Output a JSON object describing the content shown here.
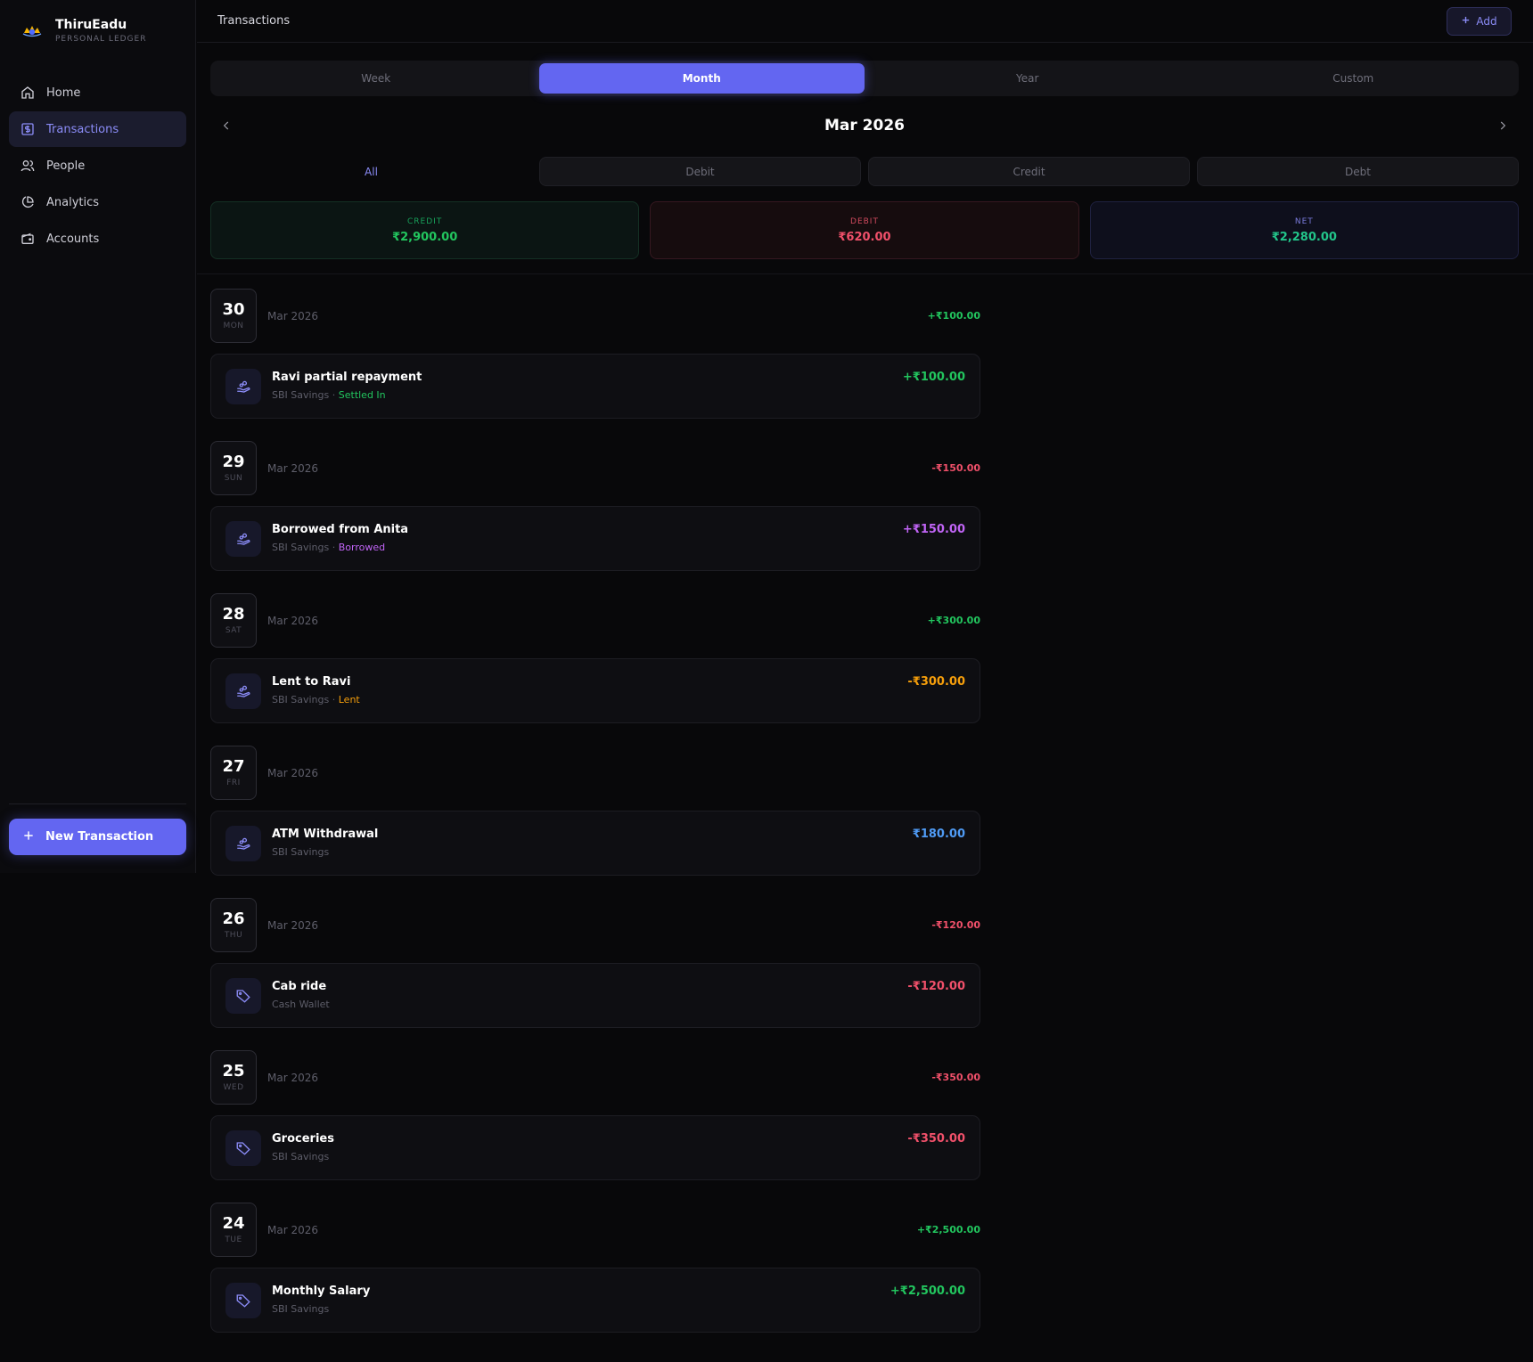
{
  "app": {
    "name": "ThiruEadu",
    "subtitle": "PERSONAL LEDGER"
  },
  "sidebar": {
    "items": [
      {
        "label": "Home",
        "icon": "home-icon",
        "active": false
      },
      {
        "label": "Transactions",
        "icon": "dollar-square-icon",
        "active": true
      },
      {
        "label": "People",
        "icon": "people-icon",
        "active": false
      },
      {
        "label": "Analytics",
        "icon": "pie-chart-icon",
        "active": false
      },
      {
        "label": "Accounts",
        "icon": "wallet-icon",
        "active": false
      }
    ],
    "new_button": "New Transaction"
  },
  "header": {
    "title": "Transactions",
    "add_label": "Add"
  },
  "period_tabs": [
    "Week",
    "Month",
    "Year",
    "Custom"
  ],
  "period_active": "Month",
  "month_label": "Mar 2026",
  "type_tabs": [
    "All",
    "Debit",
    "Credit",
    "Debt"
  ],
  "type_active": "All",
  "summary": {
    "credit_label": "CREDIT",
    "credit_value": "₹2,900.00",
    "debit_label": "DEBIT",
    "debit_value": "₹620.00",
    "net_label": "NET",
    "net_value": "₹2,280.00"
  },
  "colors": {
    "accent": "#6366f1",
    "green": "#22c55e",
    "red": "#f0506a",
    "purple": "#c064f5",
    "orange": "#f59e0b",
    "blue": "#4f9bf5"
  },
  "days": [
    {
      "day": "30",
      "dow": "MON",
      "month": "Mar 2026",
      "total": "+₹100.00",
      "total_color": "green",
      "tx": {
        "title": "Ravi partial repayment",
        "account": "SBI Savings",
        "tag": "Settled In",
        "tag_color": "green",
        "amount": "+₹100.00",
        "amount_color": "green",
        "icon": "hand-coins-icon"
      }
    },
    {
      "day": "29",
      "dow": "SUN",
      "month": "Mar 2026",
      "total": "-₹150.00",
      "total_color": "red",
      "tx": {
        "title": "Borrowed from Anita",
        "account": "SBI Savings",
        "tag": "Borrowed",
        "tag_color": "purple",
        "amount": "+₹150.00",
        "amount_color": "purple",
        "icon": "hand-coins-icon"
      }
    },
    {
      "day": "28",
      "dow": "SAT",
      "month": "Mar 2026",
      "total": "+₹300.00",
      "total_color": "green",
      "tx": {
        "title": "Lent to Ravi",
        "account": "SBI Savings",
        "tag": "Lent",
        "tag_color": "orange",
        "amount": "-₹300.00",
        "amount_color": "orange",
        "icon": "hand-coins-icon"
      }
    },
    {
      "day": "27",
      "dow": "FRI",
      "month": "Mar 2026",
      "total": "",
      "total_color": "green",
      "tx": {
        "title": "ATM Withdrawal",
        "account": "SBI Savings",
        "tag": "",
        "tag_color": "",
        "amount": "₹180.00",
        "amount_color": "blue",
        "icon": "hand-coins-icon"
      }
    },
    {
      "day": "26",
      "dow": "THU",
      "month": "Mar 2026",
      "total": "-₹120.00",
      "total_color": "red",
      "tx": {
        "title": "Cab ride",
        "account": "Cash Wallet",
        "tag": "",
        "tag_color": "",
        "amount": "-₹120.00",
        "amount_color": "red",
        "icon": "tag-icon"
      }
    },
    {
      "day": "25",
      "dow": "WED",
      "month": "Mar 2026",
      "total": "-₹350.00",
      "total_color": "red",
      "tx": {
        "title": "Groceries",
        "account": "SBI Savings",
        "tag": "",
        "tag_color": "",
        "amount": "-₹350.00",
        "amount_color": "red",
        "icon": "tag-icon"
      }
    },
    {
      "day": "24",
      "dow": "TUE",
      "month": "Mar 2026",
      "total": "+₹2,500.00",
      "total_color": "green",
      "tx": {
        "title": "Monthly Salary",
        "account": "SBI Savings",
        "tag": "",
        "tag_color": "",
        "amount": "+₹2,500.00",
        "amount_color": "green",
        "icon": "tag-icon"
      }
    }
  ]
}
